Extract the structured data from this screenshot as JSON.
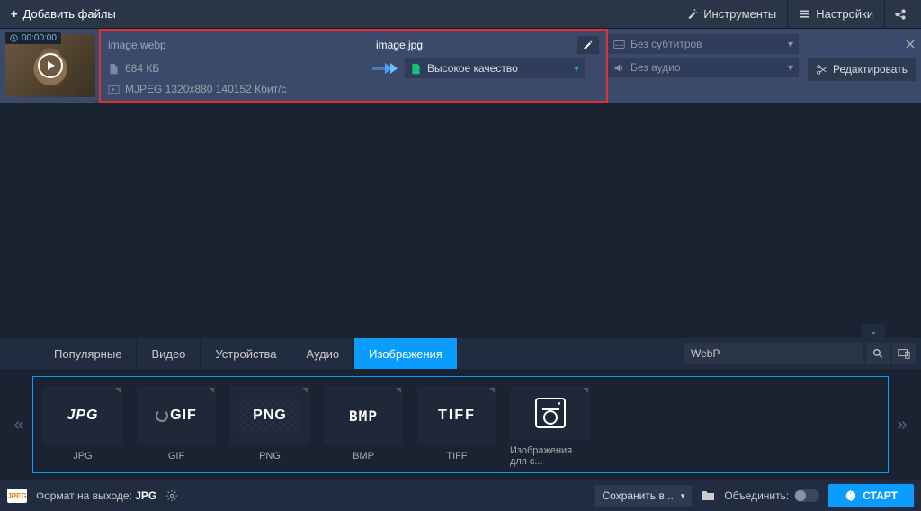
{
  "top": {
    "add_files": "Добавить файлы",
    "tools": "Инструменты",
    "settings": "Настройки"
  },
  "file": {
    "time": "00:00:00",
    "src_name": "image.webp",
    "out_name": "image.jpg",
    "size": "684 КБ",
    "quality": "Высокое качество",
    "codec": "MJPEG 1320x880 140152 Кбит/с",
    "subtitles": "Без субтитров",
    "audio": "Без аудио",
    "edit": "Редактировать"
  },
  "tabs": {
    "popular": "Популярные",
    "video": "Видео",
    "devices": "Устройства",
    "audio": "Аудио",
    "images": "Изображения",
    "search": "WebP"
  },
  "formats": {
    "jpg": "JPG",
    "gif": "GIF",
    "png": "PNG",
    "bmp": "BMP",
    "tiff": "TIFF",
    "social": "Изображения для с..."
  },
  "bottom": {
    "badge": "JPEG",
    "out_fmt_label": "Формат на выходе:",
    "out_fmt": "JPG",
    "save_to": "Сохранить в...",
    "merge": "Объединить:",
    "start": "СТАРТ"
  }
}
